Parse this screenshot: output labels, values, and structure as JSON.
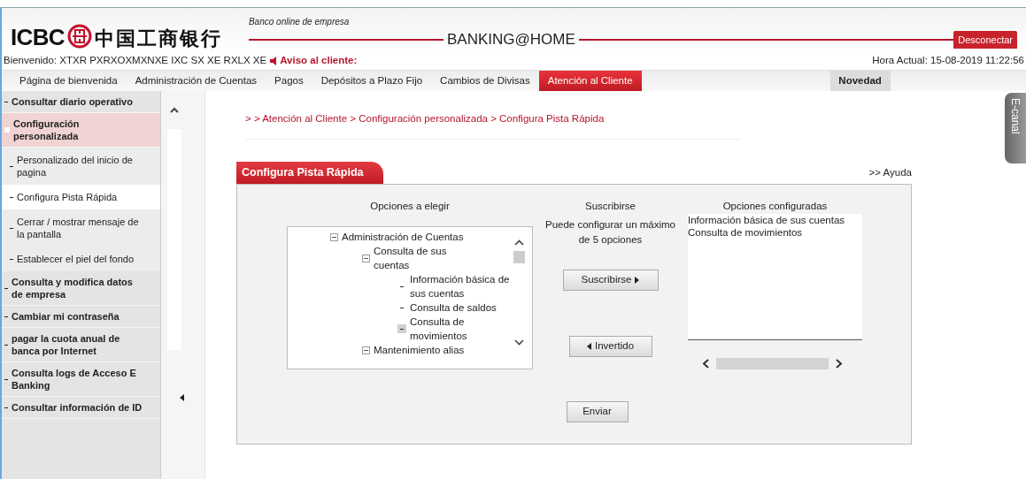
{
  "header": {
    "logo_text": "ICBC",
    "logo_chinese": "中国工商银行",
    "subtitle": "Banco online de empresa",
    "brand": "BANKING@HOME",
    "logout": "Desconectar"
  },
  "welcome": {
    "text": "Bienvenido: XTXR PXRXOXMXNXE IXC SX XE RXLX XE",
    "notice": "Aviso al cliente:",
    "time": "Hora Actual: 15-08-2019 11:22:56"
  },
  "nav": [
    {
      "label": "Página de bienvenida",
      "selected": false
    },
    {
      "label": "Administración de Cuentas",
      "selected": false
    },
    {
      "label": "Pagos",
      "selected": false
    },
    {
      "label": "Depósitos a Plazo Fijo",
      "selected": false
    },
    {
      "label": "Cambios de Divisas",
      "selected": false
    },
    {
      "label": "Atención al Cliente",
      "selected": true
    }
  ],
  "nav_right": "Novedad",
  "sidebar": [
    {
      "label": "Consultar diario operativo",
      "expanded": false
    },
    {
      "label": "Configuración personalizada",
      "expanded": true,
      "children": [
        {
          "label": "Personalizado del inicio de pagina",
          "selected": false
        },
        {
          "label": "Configura Pista Rápida",
          "selected": true
        },
        {
          "label": "Cerrar / mostrar mensaje de la pantalla",
          "selected": false
        },
        {
          "label": "Establecer el piel del fondo",
          "selected": false
        }
      ]
    },
    {
      "label": "Consulta y modifica datos de empresa",
      "expanded": false
    },
    {
      "label": "Cambiar mi contraseña",
      "expanded": false
    },
    {
      "label": "pagar la cuota anual de banca por Internet",
      "expanded": false
    },
    {
      "label": "Consulta logs de Acceso E Banking",
      "expanded": false
    },
    {
      "label": "Consultar información de ID",
      "expanded": false
    }
  ],
  "breadcrumb": "> > Atención al Cliente > Configuración personalizada > Configura Pista Rápida",
  "side_tab": "E-canal",
  "panel": {
    "title": "Configura Pista Rápida",
    "help": ">> Ayuda",
    "available_heading": "Opciones a elegir",
    "tree": [
      {
        "label": "Administración de Cuentas",
        "expanded": true,
        "children": [
          {
            "label": "Consulta de sus cuentas",
            "expanded": true,
            "children": [
              {
                "label": "Información básica de sus cuentas",
                "selected": false
              },
              {
                "label": "Consulta de saldos",
                "selected": false
              },
              {
                "label": "Consulta de movimientos",
                "selected": true
              }
            ]
          },
          {
            "label": "Mantenimiento alias",
            "expanded": true
          }
        ]
      }
    ],
    "middle_heading": "Suscribirse",
    "middle_note": "Puede configurar un máximo de 5 opciones",
    "subscribe_button": "Suscribirse",
    "invert_button": "Invertido",
    "configured_heading": "Opciones configuradas",
    "configured": [
      "Información básica de sus cuentas",
      "Consulta de movimientos"
    ],
    "send_button": "Enviar"
  }
}
